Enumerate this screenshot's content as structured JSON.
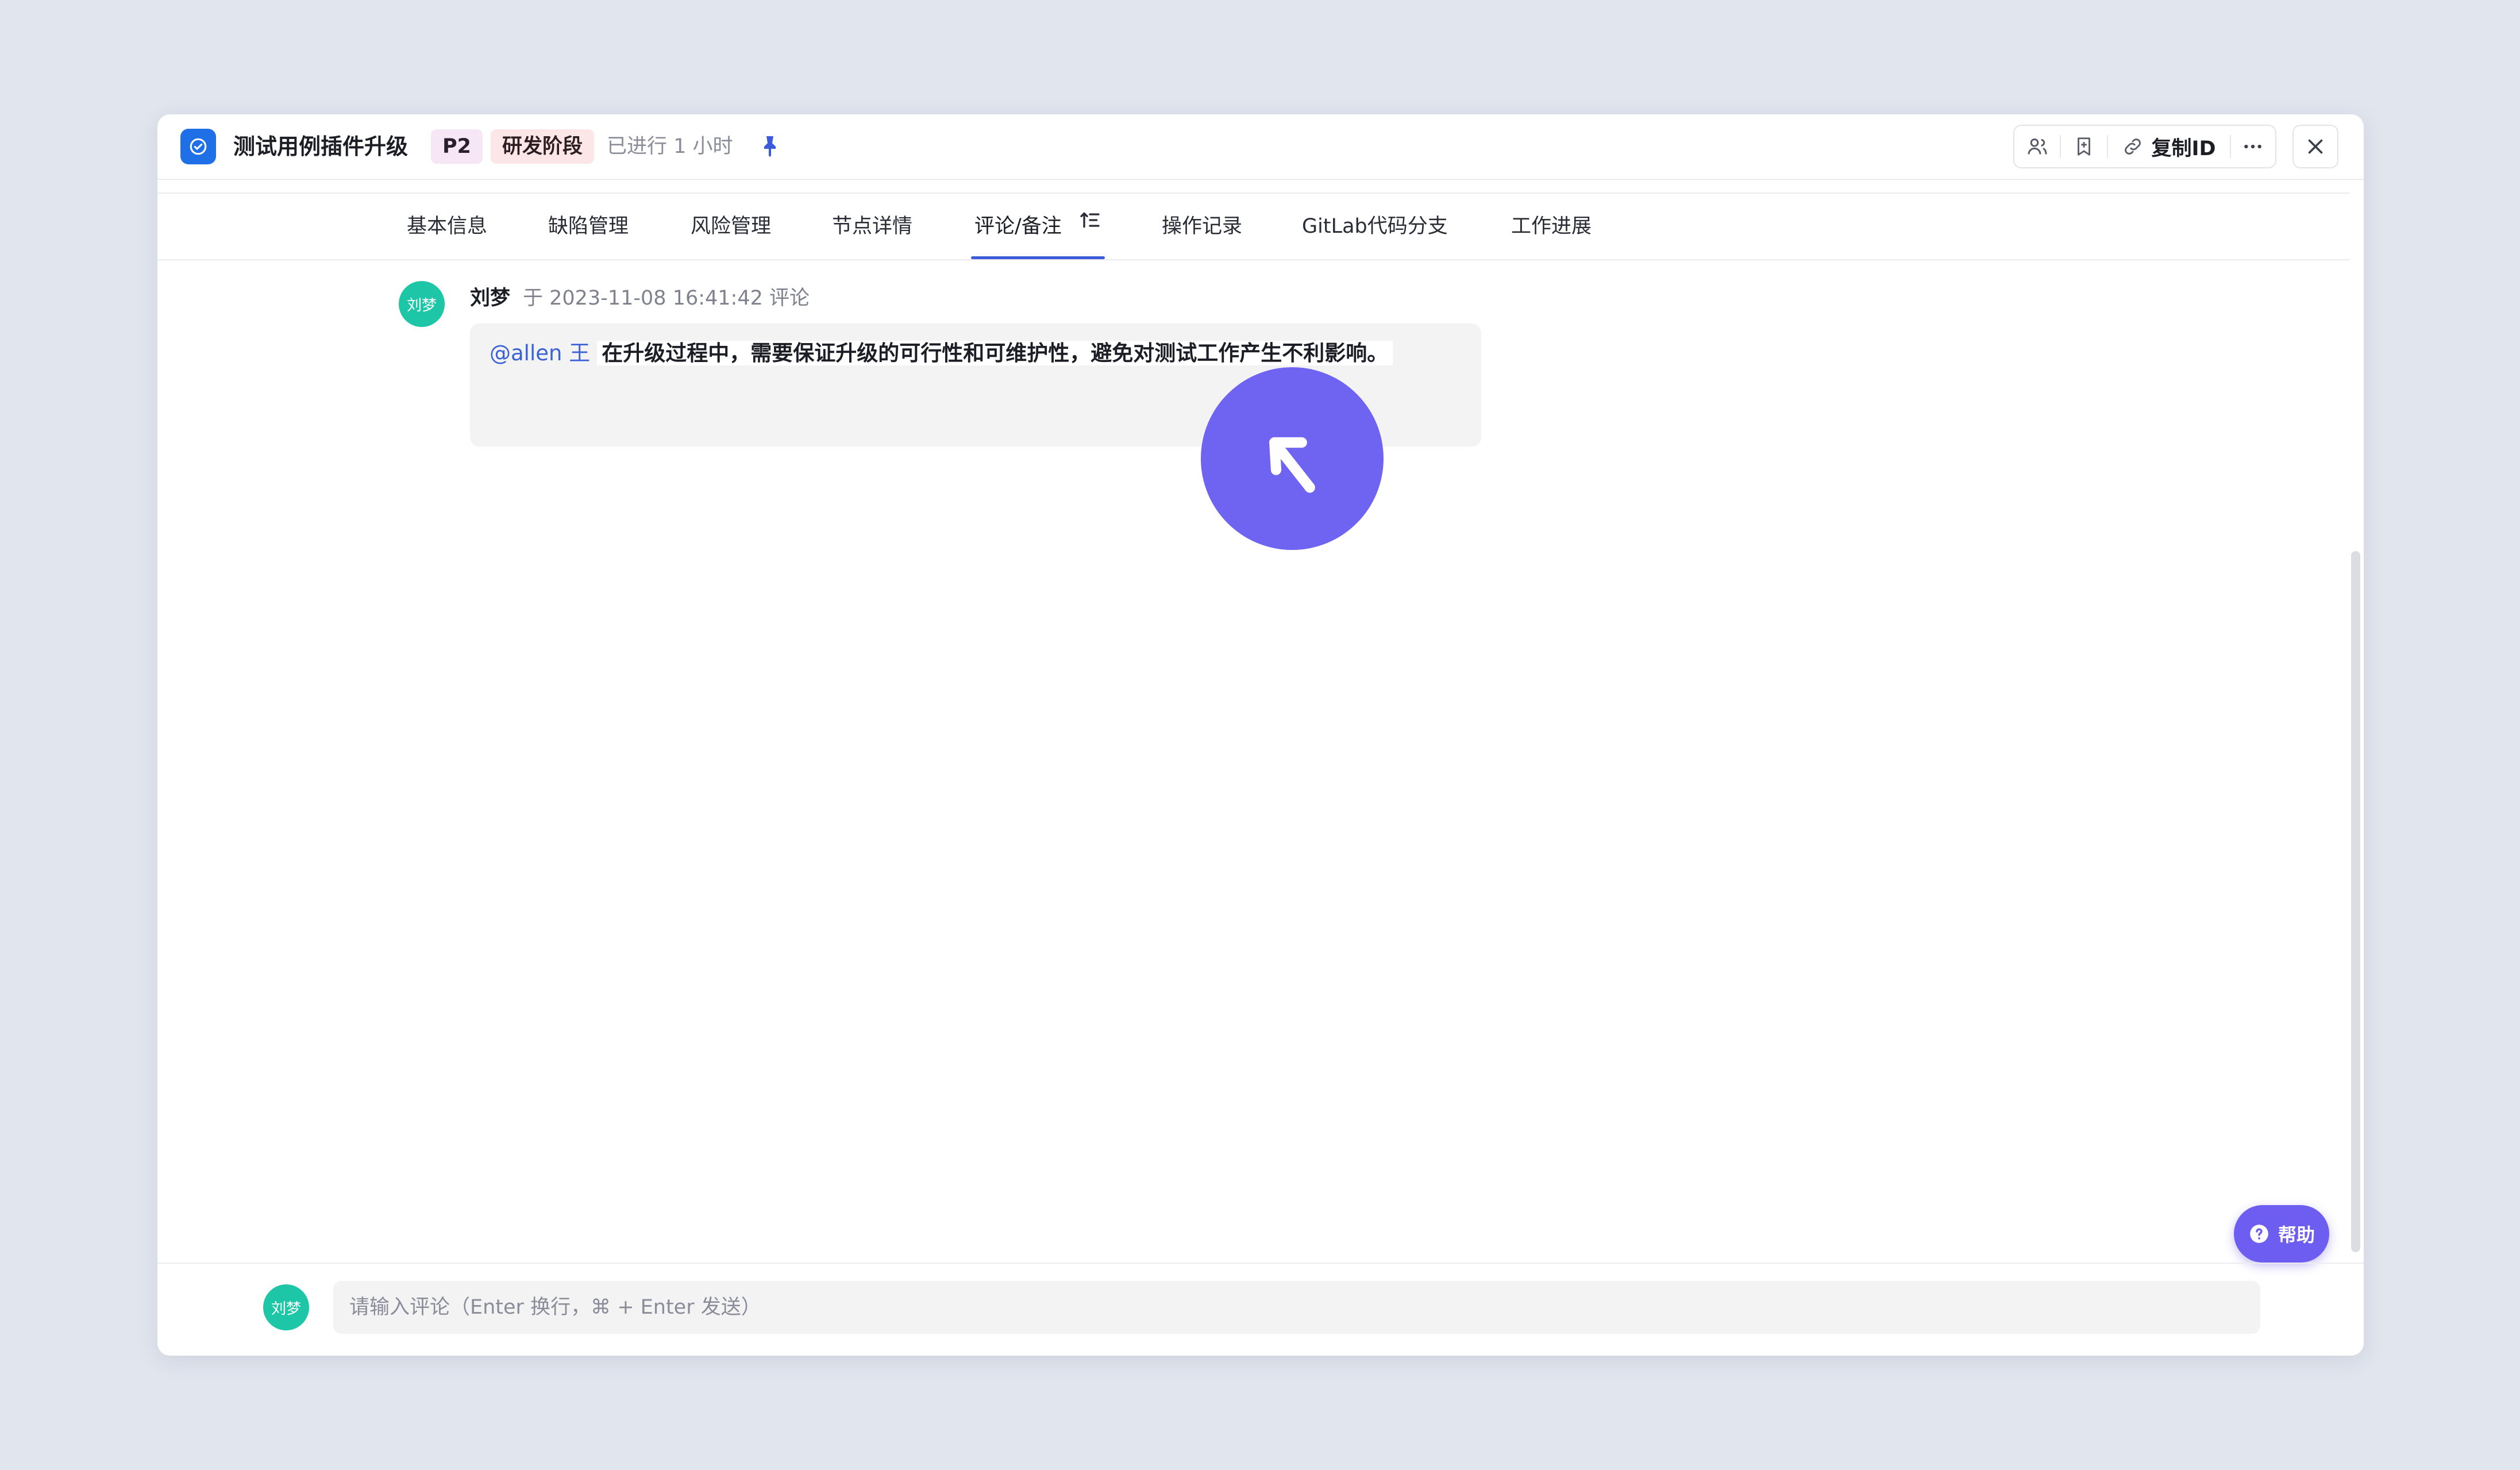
{
  "header": {
    "title": "测试用例插件升级",
    "priority": "P2",
    "stage": "研发阶段",
    "duration": "已进行 1 小时",
    "copy_id_label": "复制ID"
  },
  "tabs": [
    {
      "label": "基本信息"
    },
    {
      "label": "缺陷管理"
    },
    {
      "label": "风险管理"
    },
    {
      "label": "节点详情"
    },
    {
      "label": "评论/备注",
      "active": true
    },
    {
      "label": "操作记录"
    },
    {
      "label": "GitLab代码分支"
    },
    {
      "label": "工作进展"
    }
  ],
  "comments": [
    {
      "avatar": "刘梦",
      "author": "刘梦",
      "time": "于 2023-11-08 16:41:42 评论",
      "mention": "@allen 王",
      "text": "在升级过程中，需要保证升级的可行性和可维护性，避免对测试工作产生不利影响。"
    }
  ],
  "footer": {
    "avatar": "刘梦",
    "placeholder": "请输入评论（Enter 换行，⌘ + Enter 发送）"
  },
  "help": {
    "label": "帮助"
  },
  "colors": {
    "accent": "#3b5bdb",
    "brand": "#1f6fe6",
    "avatar": "#1cc6a6",
    "help": "#6d5df0",
    "priority_bg": "#f6e6f6",
    "stage_bg": "#fce6e8"
  },
  "icons": [
    "check-circle-icon",
    "pin-icon",
    "user-group-icon",
    "bookmark-icon",
    "link-icon",
    "more-icon",
    "close-icon",
    "sort-icon",
    "question-icon",
    "cursor-arrow-icon"
  ]
}
